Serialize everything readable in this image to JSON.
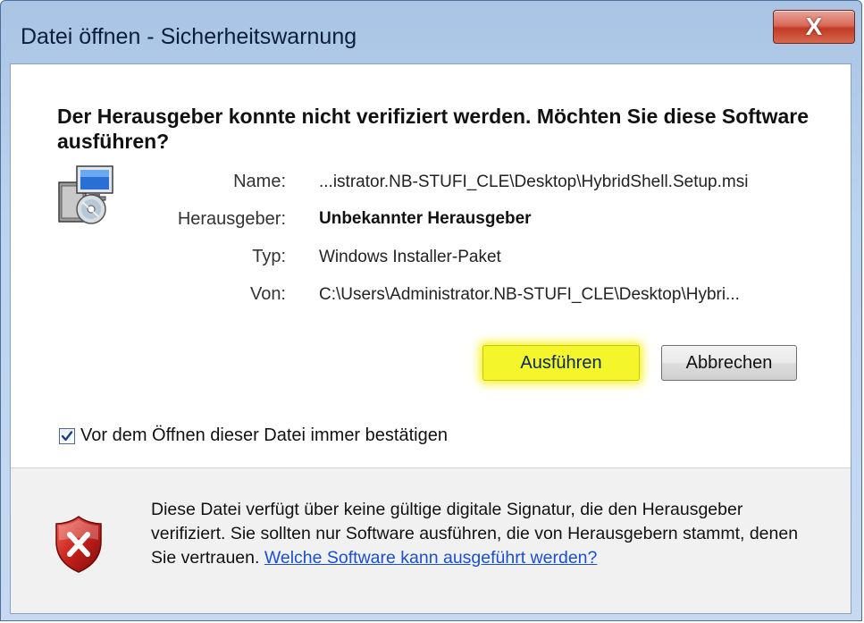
{
  "window": {
    "title": "Datei öffnen - Sicherheitswarnung",
    "close_glyph": "X"
  },
  "heading": "Der Herausgeber konnte nicht verifiziert werden. Möchten Sie diese Software ausführen?",
  "details": {
    "name_label": "Name:",
    "name_value": "...istrator.NB-STUFI_CLE\\Desktop\\HybridShell.Setup.msi",
    "publisher_label": "Herausgeber:",
    "publisher_value": "Unbekannter Herausgeber",
    "type_label": "Typ:",
    "type_value": "Windows Installer-Paket",
    "from_label": "Von:",
    "from_value": "C:\\Users\\Administrator.NB-STUFI_CLE\\Desktop\\Hybri..."
  },
  "buttons": {
    "run_label": "Ausführen",
    "cancel_label": "Abbrechen"
  },
  "checkbox": {
    "label": "Vor dem Öffnen dieser Datei immer bestätigen",
    "checked": true
  },
  "footer": {
    "text": "Diese Datei verfügt über keine gültige digitale Signatur, die den Herausgeber verifiziert. Sie sollten nur Software ausführen, die von Herausgebern stammt, denen Sie vertrauen.",
    "link_text": "Welche Software kann ausgeführt werden?"
  },
  "icons": {
    "installer": "installer-icon",
    "warning_shield": "shield-error-icon"
  },
  "colors": {
    "highlight": "#f4f52a",
    "link": "#1a4fcf",
    "shield_red": "#c8201c"
  }
}
